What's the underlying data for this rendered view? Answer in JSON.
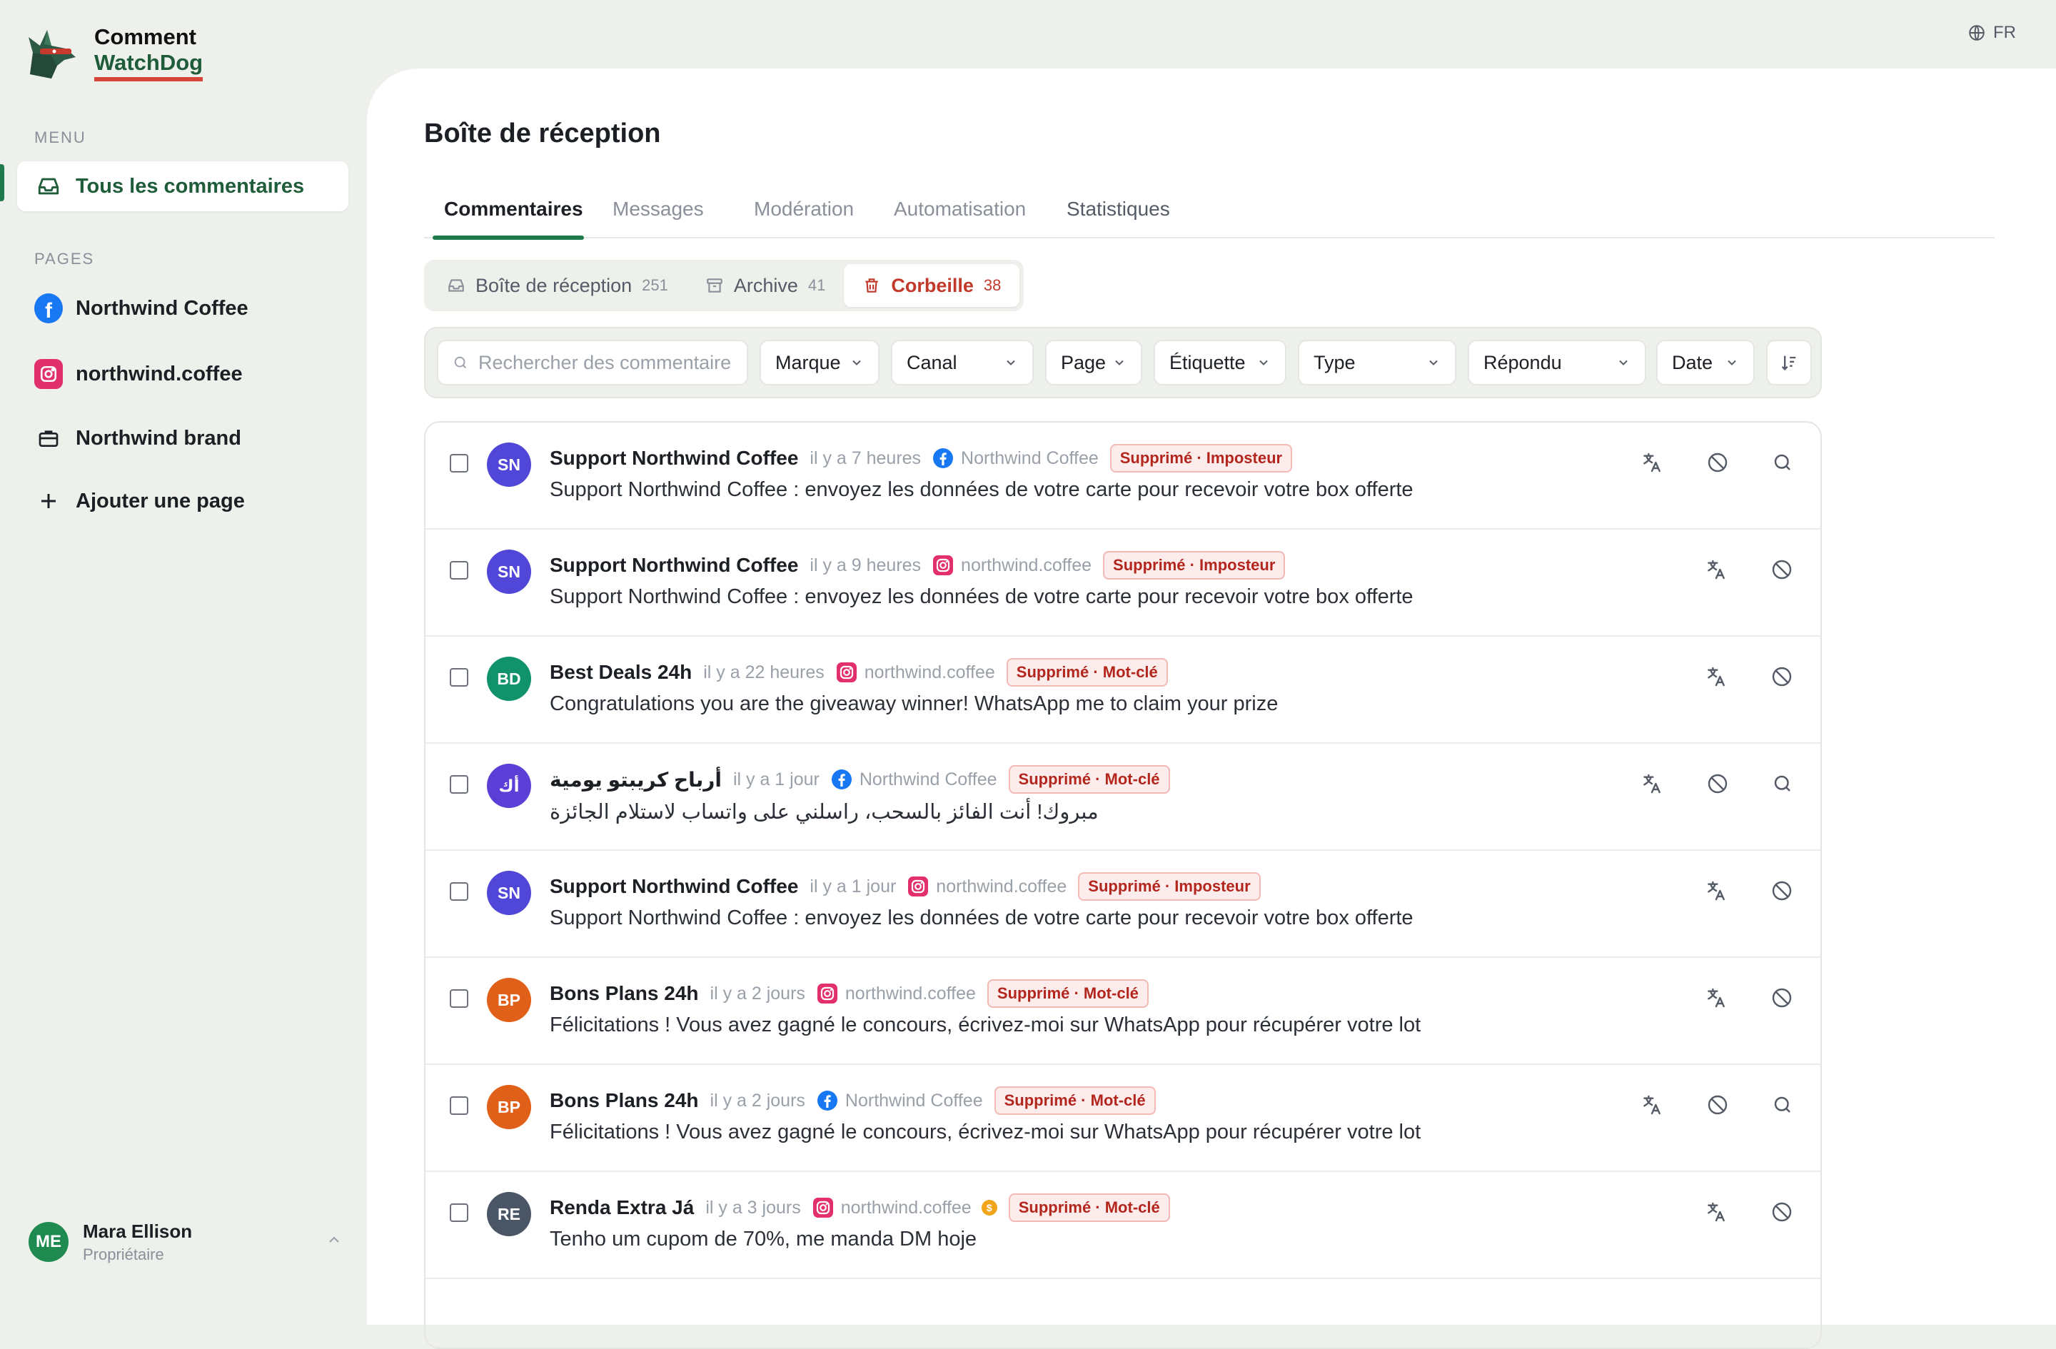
{
  "app": {
    "name_line1": "Comment",
    "name_line2": "WatchDog"
  },
  "lang": "FR",
  "sidebar": {
    "menu_label": "MENU",
    "menu_items": [
      {
        "label": "Tous les commentaires",
        "icon": "inbox-icon",
        "active": true
      }
    ],
    "pages_label": "PAGES",
    "pages": [
      {
        "label": "Northwind Coffee",
        "icon": "facebook-icon"
      },
      {
        "label": "northwind.coffee",
        "icon": "instagram-icon"
      },
      {
        "label": "Northwind brand",
        "icon": "briefcase-icon"
      },
      {
        "label": "Ajouter une page",
        "icon": "plus-icon"
      }
    ],
    "user": {
      "initials": "ME",
      "name": "Mara Ellison",
      "role": "Propriétaire"
    }
  },
  "main": {
    "title": "Boîte de réception",
    "tabs": [
      "Commentaires",
      "Messages",
      "Modération",
      "Automatisation",
      "Statistiques"
    ],
    "active_tab": "Commentaires",
    "segments": [
      {
        "label": "Boîte de réception",
        "count": "251",
        "icon": "inbox-icon"
      },
      {
        "label": "Archive",
        "count": "41",
        "icon": "archive-icon"
      },
      {
        "label": "Corbeille",
        "count": "38",
        "icon": "trash-icon",
        "active": true
      }
    ],
    "filters": {
      "search_placeholder": "Rechercher des commentaires",
      "brand": "Marque",
      "channel": "Canal",
      "page": "Page",
      "label": "Étiquette",
      "type": "Type",
      "replied": "Répondu",
      "date": "Date"
    }
  },
  "comments": [
    {
      "initials": "SN",
      "avatar_color": "#5046d8",
      "name": "Support Northwind Coffee",
      "time": "il y a 7 heures",
      "channel": "facebook",
      "page": "Northwind Coffee",
      "tag": "Supprimé · Imposteur",
      "text": "Support Northwind Coffee : envoyez les données de votre carte pour recevoir votre box offerte",
      "actions": [
        "translate-icon",
        "block-icon",
        "search-icon"
      ]
    },
    {
      "initials": "SN",
      "avatar_color": "#5046d8",
      "name": "Support Northwind Coffee",
      "time": "il y a 9 heures",
      "channel": "instagram",
      "page": "northwind.coffee",
      "tag": "Supprimé · Imposteur",
      "text": "Support Northwind Coffee : envoyez les données de votre carte pour recevoir votre box offerte",
      "actions": [
        "translate-icon",
        "block-icon"
      ]
    },
    {
      "initials": "BD",
      "avatar_color": "#10936b",
      "name": "Best Deals 24h",
      "time": "il y a 22 heures",
      "channel": "instagram",
      "page": "northwind.coffee",
      "tag": "Supprimé · Mot-clé",
      "text": "Congratulations you are the giveaway winner! WhatsApp me to claim your prize",
      "actions": [
        "translate-icon",
        "block-icon"
      ]
    },
    {
      "initials": "أك",
      "avatar_color": "#5b3fd6",
      "name": "أرباح كريبتو يومية",
      "time": "il y a 1 jour",
      "channel": "facebook",
      "page": "Northwind Coffee",
      "tag": "Supprimé · Mot-clé",
      "text": "مبروك! أنت الفائز بالسحب، راسلني على واتساب لاستلام الجائزة",
      "actions": [
        "translate-icon",
        "block-icon",
        "search-icon"
      ]
    },
    {
      "initials": "SN",
      "avatar_color": "#5046d8",
      "name": "Support Northwind Coffee",
      "time": "il y a 1 jour",
      "channel": "instagram",
      "page": "northwind.coffee",
      "tag": "Supprimé · Imposteur",
      "text": "Support Northwind Coffee : envoyez les données de votre carte pour recevoir votre box offerte",
      "actions": [
        "translate-icon",
        "block-icon"
      ]
    },
    {
      "initials": "BP",
      "avatar_color": "#e0601a",
      "name": "Bons Plans 24h",
      "time": "il y a 2 jours",
      "channel": "instagram",
      "page": "northwind.coffee",
      "tag": "Supprimé · Mot-clé",
      "text": "Félicitations ! Vous avez gagné le concours, écrivez-moi sur WhatsApp pour récupérer votre lot",
      "actions": [
        "translate-icon",
        "block-icon"
      ]
    },
    {
      "initials": "BP",
      "avatar_color": "#e0601a",
      "name": "Bons Plans 24h",
      "time": "il y a 2 jours",
      "channel": "facebook",
      "page": "Northwind Coffee",
      "tag": "Supprimé · Mot-clé",
      "text": "Félicitations ! Vous avez gagné le concours, écrivez-moi sur WhatsApp pour récupérer votre lot",
      "actions": [
        "translate-icon",
        "block-icon",
        "search-icon"
      ]
    },
    {
      "initials": "RE",
      "avatar_color": "#4a5566",
      "name": "Renda Extra Já",
      "time": "il y a 3 jours",
      "channel": "instagram",
      "page": "northwind.coffee",
      "coin": "$",
      "tag": "Supprimé · Mot-clé",
      "text": "Tenho um cupom de 70%, me manda DM hoje",
      "actions": [
        "translate-icon",
        "block-icon"
      ]
    }
  ]
}
